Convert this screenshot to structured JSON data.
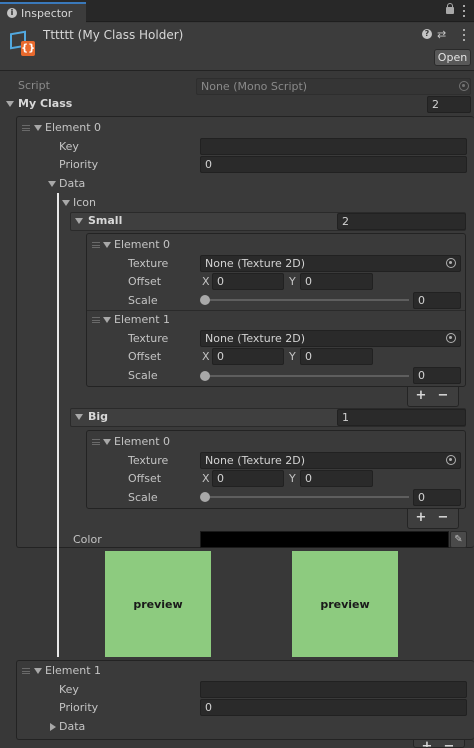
{
  "tab": {
    "title": "Inspector"
  },
  "header": {
    "object_name": "Tttttt (My Class Holder)",
    "open_label": "Open"
  },
  "script_row": {
    "label": "Script",
    "value": "None (Mono Script)"
  },
  "my_class": {
    "label": "My Class",
    "size": "2"
  },
  "element0": {
    "label": "Element 0",
    "key_label": "Key",
    "key_value": "",
    "priority_label": "Priority",
    "priority_value": "0",
    "data_label": "Data",
    "icon_label": "Icon",
    "small": {
      "label": "Small",
      "size": "2",
      "items": [
        {
          "label": "Element 0",
          "texture_label": "Texture",
          "texture_value": "None (Texture 2D)",
          "offset_label": "Offset",
          "x_label": "X",
          "x_value": "0",
          "y_label": "Y",
          "y_value": "0",
          "scale_label": "Scale",
          "scale_value": "0"
        },
        {
          "label": "Element 1",
          "texture_label": "Texture",
          "texture_value": "None (Texture 2D)",
          "offset_label": "Offset",
          "x_label": "X",
          "x_value": "0",
          "y_label": "Y",
          "y_value": "0",
          "scale_label": "Scale",
          "scale_value": "0"
        }
      ]
    },
    "big": {
      "label": "Big",
      "size": "1",
      "items": [
        {
          "label": "Element 0",
          "texture_label": "Texture",
          "texture_value": "None (Texture 2D)",
          "offset_label": "Offset",
          "x_label": "X",
          "x_value": "0",
          "y_label": "Y",
          "y_value": "0",
          "scale_label": "Scale",
          "scale_value": "0"
        }
      ]
    },
    "color_label": "Color",
    "color_value": "#000000",
    "previews": [
      "preview",
      "preview"
    ]
  },
  "element1": {
    "label": "Element 1",
    "key_label": "Key",
    "key_value": "",
    "priority_label": "Priority",
    "priority_value": "0",
    "data_label": "Data"
  },
  "list_buttons": {
    "plus": "+",
    "minus": "−"
  },
  "colors": {
    "preview_bg": "#8dcb7f",
    "tab_accent": "#3a79bb",
    "background": "#383838"
  }
}
